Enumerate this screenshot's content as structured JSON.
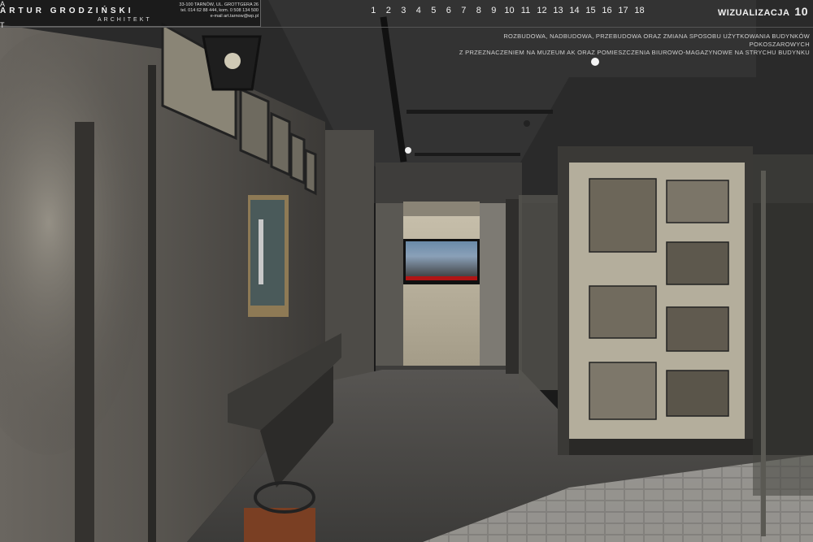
{
  "header": {
    "logo_letters": [
      "A",
      "A",
      "T"
    ],
    "logo_name": "ARTUR GRODZIŃSKI",
    "logo_sub": "ARCHITEKT",
    "address_lines": [
      "33-100 TARNÓW, UL. GROTTGERA 26",
      "tel. 014 62 88 444, kom. 0 508 134 500",
      "e-mail art.tarnow@wp.pl"
    ],
    "pages": [
      "1",
      "2",
      "3",
      "4",
      "5",
      "6",
      "7",
      "8",
      "9",
      "10",
      "11",
      "12",
      "13",
      "14",
      "15",
      "16",
      "17",
      "18"
    ],
    "title_label": "WIZUALIZACJA",
    "title_number": "10",
    "description_lines": [
      "ROZBUDOWA, NADBUDOWA, PRZEBUDOWA ORAZ ZMIANA SPOSOBU UŻYTKOWANIA BUDYNKÓW POKOSZAROWYCH",
      "Z PRZEZNACZENIEM NA MUZEUM AK ORAZ POMIESZCZENIA BIUROWO-MAGAZYNOWE NA STRYCHU BUDYNKU"
    ]
  },
  "colors": {
    "wall": "#4a4844",
    "floor": "#4e4d4b",
    "panel": "#b4ae9c",
    "text": "#f0f0f0"
  }
}
